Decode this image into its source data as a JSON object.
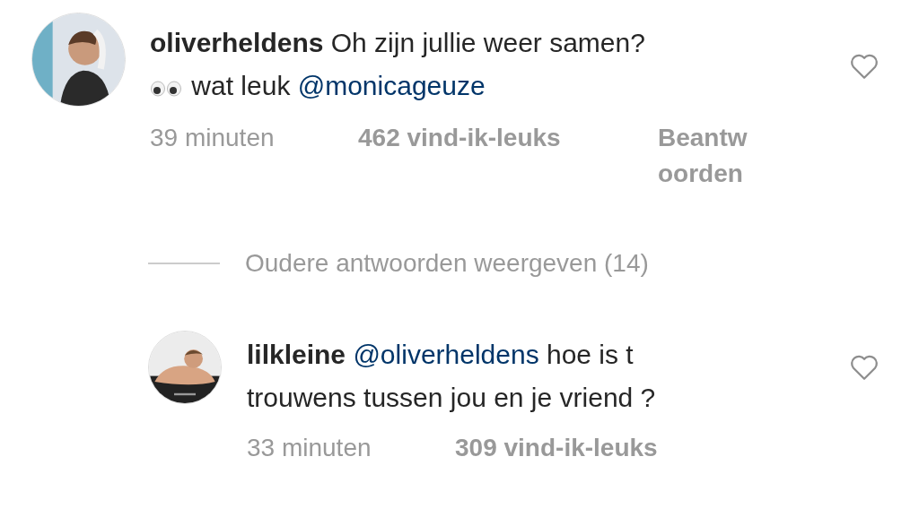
{
  "comments": [
    {
      "username": "oliverheldens",
      "avatar": {
        "kind": "picture"
      },
      "lines": [
        [
          {
            "kind": "text",
            "text": "Oh zijn jullie weer samen?"
          }
        ],
        [
          {
            "kind": "eyes"
          },
          {
            "kind": "text",
            "text": " wat leuk "
          },
          {
            "kind": "mention",
            "text": "@monicageuze"
          }
        ]
      ],
      "time": "39 minuten",
      "likes": "462 vind-ik-leuks",
      "reply": "Beantwoorden",
      "liked": false,
      "thread": {
        "label": "Oudere antwoorden weergeven (14)"
      },
      "replies": [
        {
          "username": "lilkleine",
          "avatar": {
            "kind": "picture"
          },
          "lines": [
            [
              {
                "kind": "mention",
                "text": "@oliverheldens"
              },
              {
                "kind": "text",
                "text": " hoe is t"
              }
            ],
            [
              {
                "kind": "text",
                "text": "trouwens tussen jou en je vriend ?"
              }
            ]
          ],
          "time": "33 minuten",
          "likes": "309 vind-ik-leuks",
          "liked": false
        }
      ]
    }
  ]
}
